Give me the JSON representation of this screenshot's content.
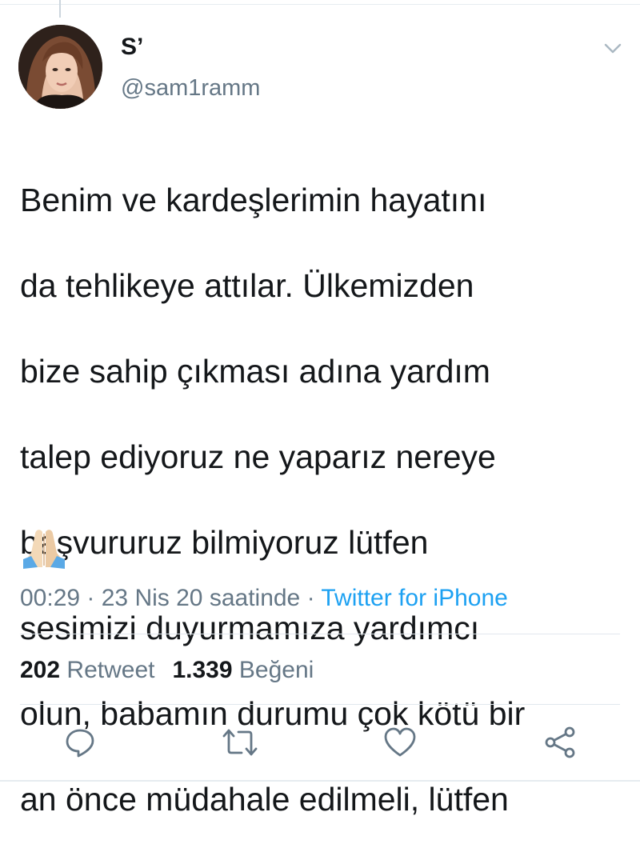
{
  "author": {
    "display_name": "S’",
    "handle": "@sam1ramm",
    "avatar_icon": "profile-photo"
  },
  "tweet": {
    "lines": [
      "Benim ve kardeşlerimin hayatını",
      "da tehlikeye attılar. Ülkemizden",
      "bize sahip çıkması adına yardım",
      "talep ediyoruz ne yaparız nereye",
      "başvururuz bilmiyoruz lütfen",
      "sesimizi duyurmamıza yardımcı",
      "olun, babamın durumu çok kötü bir",
      "an önce müdahale edilmeli, lütfen"
    ],
    "emoji": "🙏🏼"
  },
  "meta": {
    "time": "00:29",
    "separator": " · ",
    "date": "23 Nis 20 saatinde",
    "source": "Twitter for iPhone"
  },
  "stats": {
    "retweet_count": "202",
    "retweet_label": "Retweet",
    "like_count": "1.339",
    "like_label": "Beğeni"
  },
  "actions": [
    "reply-icon",
    "retweet-icon",
    "like-icon",
    "share-icon"
  ],
  "colors": {
    "text": "#14171a",
    "secondary": "#657786",
    "link": "#1da1f2",
    "divider": "#e1e8ed"
  }
}
